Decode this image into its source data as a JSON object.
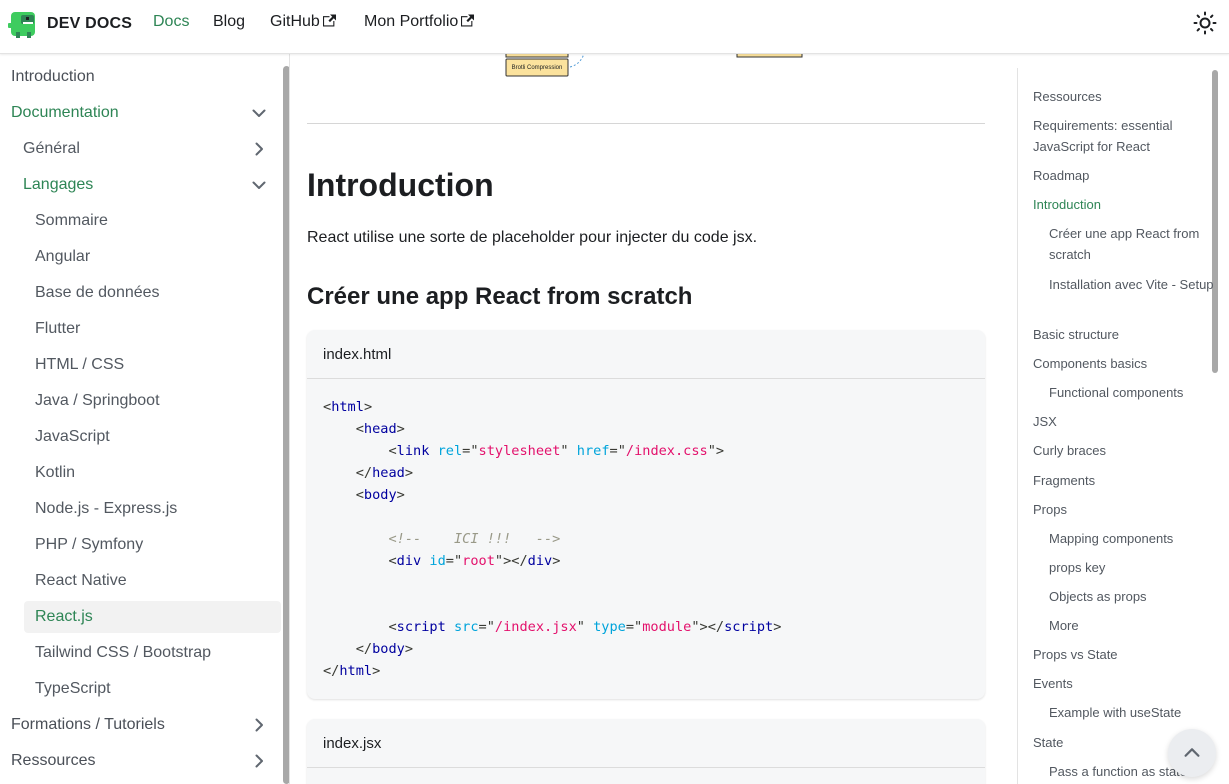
{
  "colors": {
    "primary": "#2e8555",
    "text": "#1c1e21",
    "muted": "#525860",
    "code_bg": "#f6f7f8"
  },
  "navbar": {
    "brand_title": "DEV DOCS",
    "logo_icon": "dinosaur-logo-icon",
    "links": [
      {
        "label": "Docs",
        "active": true,
        "external": false
      },
      {
        "label": "Blog",
        "active": false,
        "external": false
      },
      {
        "label": "GitHub",
        "active": false,
        "external": true
      },
      {
        "label": "Mon Portfolio",
        "active": false,
        "external": true
      }
    ],
    "theme_toggle_icon": "sun-icon"
  },
  "sidebar": {
    "items": [
      {
        "label": "Introduction",
        "level": 0
      },
      {
        "label": "Documentation",
        "level": 0,
        "expanded": true,
        "active": true
      },
      {
        "label": "Général",
        "level": 1,
        "collapsed": true
      },
      {
        "label": "Langages",
        "level": 1,
        "expanded": true,
        "active": true
      },
      {
        "label": "Sommaire",
        "level": 2
      },
      {
        "label": "Angular",
        "level": 2
      },
      {
        "label": "Base de données",
        "level": 2
      },
      {
        "label": "Flutter",
        "level": 2
      },
      {
        "label": "HTML / CSS",
        "level": 2
      },
      {
        "label": "Java / Springboot",
        "level": 2
      },
      {
        "label": "JavaScript",
        "level": 2
      },
      {
        "label": "Kotlin",
        "level": 2
      },
      {
        "label": "Node.js - Express.js",
        "level": 2
      },
      {
        "label": "PHP / Symfony",
        "level": 2
      },
      {
        "label": "React Native",
        "level": 2
      },
      {
        "label": "React.js",
        "level": 2,
        "selected": true
      },
      {
        "label": "Tailwind CSS / Bootstrap",
        "level": 2
      },
      {
        "label": "TypeScript",
        "level": 2
      },
      {
        "label": "Formations / Tutoriels",
        "level": 0,
        "collapsed": true
      },
      {
        "label": "Ressources",
        "level": 0,
        "collapsed": true
      }
    ]
  },
  "main": {
    "diagram_label": "Brotli Compression",
    "heading": "Introduction",
    "paragraph": "React utilise une sorte de placeholder pour injecter du code jsx.",
    "subheading": "Créer une app React from scratch",
    "code_blocks": [
      {
        "title": "index.html",
        "lines": [
          [
            [
              "pn",
              "<"
            ],
            [
              "tg",
              "html"
            ],
            [
              "pn",
              ">"
            ]
          ],
          [
            [
              "pn",
              "    <"
            ],
            [
              "tg",
              "head"
            ],
            [
              "pn",
              ">"
            ]
          ],
          [
            [
              "pn",
              "        <"
            ],
            [
              "tg",
              "link"
            ],
            [
              "pn",
              " "
            ],
            [
              "at",
              "rel"
            ],
            [
              "pn",
              "=\""
            ],
            [
              "st",
              "stylesheet"
            ],
            [
              "pn",
              "\" "
            ],
            [
              "at",
              "href"
            ],
            [
              "pn",
              "=\""
            ],
            [
              "st",
              "/index.css"
            ],
            [
              "pn",
              "\">"
            ]
          ],
          [
            [
              "pn",
              "    </"
            ],
            [
              "tg",
              "head"
            ],
            [
              "pn",
              ">"
            ]
          ],
          [
            [
              "pn",
              "    <"
            ],
            [
              "tg",
              "body"
            ],
            [
              "pn",
              ">"
            ]
          ],
          [],
          [
            [
              "pn",
              "        "
            ],
            [
              "cm",
              "<!--    ICI !!!   -->"
            ]
          ],
          [
            [
              "pn",
              "        <"
            ],
            [
              "tg",
              "div"
            ],
            [
              "pn",
              " "
            ],
            [
              "at",
              "id"
            ],
            [
              "pn",
              "=\""
            ],
            [
              "st",
              "root"
            ],
            [
              "pn",
              "\"></"
            ],
            [
              "tg",
              "div"
            ],
            [
              "pn",
              ">"
            ]
          ],
          [],
          [],
          [
            [
              "pn",
              "        <"
            ],
            [
              "tg",
              "script"
            ],
            [
              "pn",
              " "
            ],
            [
              "at",
              "src"
            ],
            [
              "pn",
              "=\""
            ],
            [
              "st",
              "/index.jsx"
            ],
            [
              "pn",
              "\" "
            ],
            [
              "at",
              "type"
            ],
            [
              "pn",
              "=\""
            ],
            [
              "st",
              "module"
            ],
            [
              "pn",
              "\"></"
            ],
            [
              "tg",
              "script"
            ],
            [
              "pn",
              ">"
            ]
          ],
          [
            [
              "pn",
              "    </"
            ],
            [
              "tg",
              "body"
            ],
            [
              "pn",
              ">"
            ]
          ],
          [
            [
              "pn",
              "</"
            ],
            [
              "tg",
              "html"
            ],
            [
              "pn",
              ">"
            ]
          ]
        ]
      },
      {
        "title": "index.jsx",
        "lines": []
      }
    ]
  },
  "toc": {
    "items": [
      {
        "label": "Ressources",
        "level": 1
      },
      {
        "label": "Requirements: essential JavaScript for React",
        "level": 1
      },
      {
        "label": "Roadmap",
        "level": 1
      },
      {
        "label": "Introduction",
        "level": 1,
        "active": true
      },
      {
        "label": "Créer une app React from scratch",
        "level": 2
      },
      {
        "label": "Installation avec Vite - Setup",
        "level": 2
      },
      {
        "label": "Basic structure",
        "level": 1
      },
      {
        "label": "Components basics",
        "level": 1
      },
      {
        "label": "Functional components",
        "level": 2
      },
      {
        "label": "JSX",
        "level": 1
      },
      {
        "label": "Curly braces",
        "level": 1
      },
      {
        "label": "Fragments",
        "level": 1
      },
      {
        "label": "Props",
        "level": 1
      },
      {
        "label": "Mapping components",
        "level": 2
      },
      {
        "label": "props key",
        "level": 2
      },
      {
        "label": "Objects as props",
        "level": 2
      },
      {
        "label": "More",
        "level": 2
      },
      {
        "label": "Props vs State",
        "level": 1
      },
      {
        "label": "Events",
        "level": 1
      },
      {
        "label": "Example with useState",
        "level": 2
      },
      {
        "label": "State",
        "level": 1
      },
      {
        "label": "Pass a function as state",
        "level": 2
      }
    ]
  },
  "back_to_top_icon": "chevron-up-icon"
}
